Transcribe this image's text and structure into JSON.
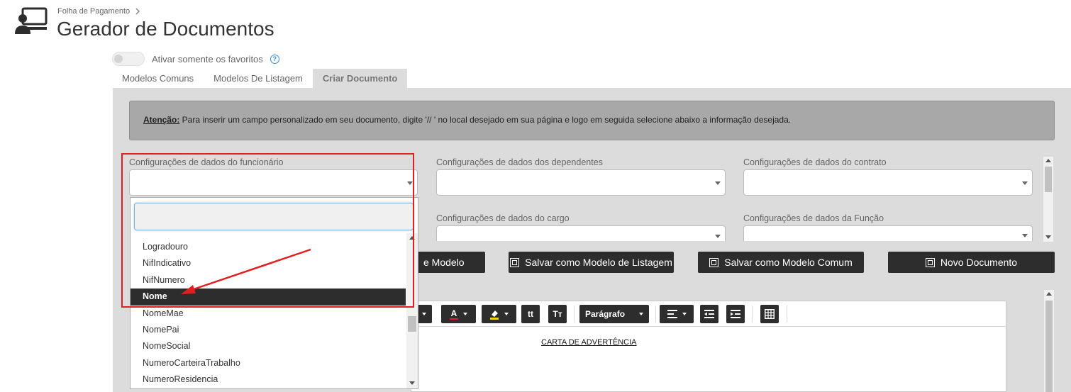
{
  "header": {
    "breadcrumb": "Folha de Pagamento",
    "breadcrumb_icon": "chevron-right-icon",
    "title": "Gerador de Documentos",
    "app_icon": "presentation-user-icon"
  },
  "favorites_toggle": {
    "label": "Ativar somente os favoritos",
    "state": "off",
    "help_icon": "question-circle-icon",
    "help_glyph": "?"
  },
  "tabs": [
    {
      "label": "Modelos Comuns"
    },
    {
      "label": "Modelos De Listagem"
    },
    {
      "label": "Criar Documento",
      "active": true
    }
  ],
  "notice": {
    "prefix": "Atenção:",
    "text": " Para inserir um campo personalizado em seu documento, digite '// ' no local desejado em sua página e logo em seguida selecione abaixo a informação desejada."
  },
  "fields": {
    "employee": {
      "label": "Configurações de dados do funcionário",
      "value": ""
    },
    "dependents": {
      "label": "Configurações de dados dos dependentes",
      "value": ""
    },
    "contract": {
      "label": "Configurações de dados do contrato",
      "value": ""
    },
    "position": {
      "label": "Configurações de dados do cargo",
      "value": ""
    },
    "function": {
      "label": "Configurações de dados da Função",
      "value": ""
    }
  },
  "buttons": {
    "save_model_partial": "e Modelo",
    "save_listing": "Salvar como Modelo de Listagem",
    "save_common": "Salvar como Modelo Comum",
    "new_document": "Novo Documento",
    "icon": "copy-icon"
  },
  "toolbar": {
    "font_color": "A",
    "highlight": "highlighter-icon",
    "text_size_small": "tt",
    "text_size_large": "Tт",
    "paragraph": "Parágrafo",
    "align": "align-left-icon",
    "outdent": "outdent-icon",
    "indent": "indent-icon",
    "table": "table-icon",
    "font_color_underline": "#e02020",
    "highlight_underline": "#f5d300"
  },
  "document": {
    "title": "CARTA DE ADVERTÊNCIA"
  },
  "dropdown": {
    "search_value": "",
    "items": [
      {
        "label": "Logradouro"
      },
      {
        "label": "NifIndicativo"
      },
      {
        "label": "NifNumero"
      },
      {
        "label": "Nome",
        "selected": true
      },
      {
        "label": "NomeMae"
      },
      {
        "label": "NomePai"
      },
      {
        "label": "NomeSocial"
      },
      {
        "label": "NumeroCarteiraTrabalho"
      },
      {
        "label": "NumeroResidencia"
      }
    ]
  },
  "colors": {
    "accent_dark": "#2d2d2d",
    "annotation_red": "#e02020",
    "panel_bg": "#dcdcdc",
    "notice_bg": "#a8a8a8"
  }
}
